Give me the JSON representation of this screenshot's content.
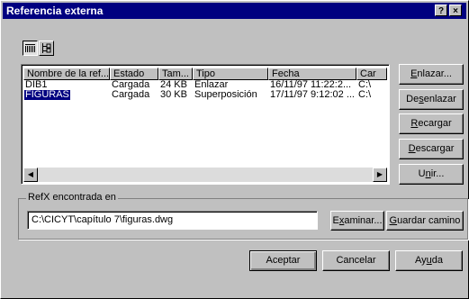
{
  "window": {
    "title": "Referencia externa",
    "help_btn": "?",
    "close_btn": "×"
  },
  "list": {
    "columns": [
      "Nombre de la ref...",
      "Estado",
      "Tam...",
      "Tipo",
      "Fecha",
      "Car"
    ],
    "rows": [
      {
        "name": "DIB1",
        "estado": "Cargada",
        "tam": "24 KB",
        "tipo": "Enlazar",
        "fecha": "16/11/97 11:22:2...",
        "car": "C:\\"
      },
      {
        "name": "FIGURAS",
        "estado": "Cargada",
        "tam": "30 KB",
        "tipo": "Superposición",
        "fecha": "17/11/97 9:12:02 ...",
        "car": "C:\\"
      }
    ]
  },
  "side_buttons": {
    "enlazar": {
      "before": "",
      "mn": "E",
      "after": "nlazar..."
    },
    "desenlazar": {
      "before": "De",
      "mn": "s",
      "after": "enlazar"
    },
    "recargar": {
      "before": "",
      "mn": "R",
      "after": "ecargar"
    },
    "descargar": {
      "before": "",
      "mn": "D",
      "after": "escargar"
    },
    "unir": {
      "before": "U",
      "mn": "n",
      "after": "ir..."
    }
  },
  "found": {
    "label": "RefX encontrada en",
    "path": "C:\\CICYT\\capítulo 7\\figuras.dwg",
    "examinar": {
      "before": "E",
      "mn": "x",
      "after": "aminar..."
    },
    "guardar": {
      "before": "",
      "mn": "G",
      "after": "uardar camino"
    }
  },
  "footer": {
    "aceptar": "Aceptar",
    "cancelar": "Cancelar",
    "ayuda": {
      "before": "Ay",
      "mn": "u",
      "after": "da"
    }
  }
}
